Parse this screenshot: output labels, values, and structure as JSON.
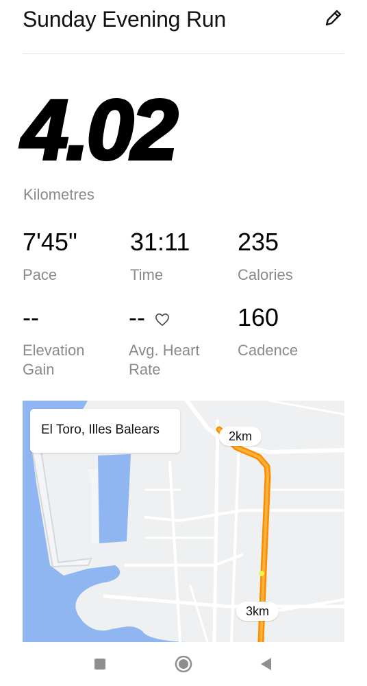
{
  "header": {
    "title": "Sunday Evening Run"
  },
  "distance": {
    "value": "4.02",
    "unit": "Kilometres"
  },
  "stats": [
    {
      "value": "7'45\"",
      "label": "Pace"
    },
    {
      "value": "31:11",
      "label": "Time"
    },
    {
      "value": "235",
      "label": "Calories"
    },
    {
      "value": "--",
      "label": "Elevation Gain"
    },
    {
      "value": "--",
      "label": "Avg. Heart Rate"
    },
    {
      "value": "160",
      "label": "Cadence"
    }
  ],
  "map": {
    "location": "El Toro, Illes Balears",
    "markers": [
      "2km",
      "3km"
    ],
    "route_color": "#f29a1a",
    "water_color": "#8fb6f0"
  },
  "icons": {
    "edit": "pencil-icon",
    "heart": "heart-outline-icon",
    "nav": [
      "square-stop-icon",
      "circle-home-icon",
      "triangle-back-icon"
    ]
  }
}
